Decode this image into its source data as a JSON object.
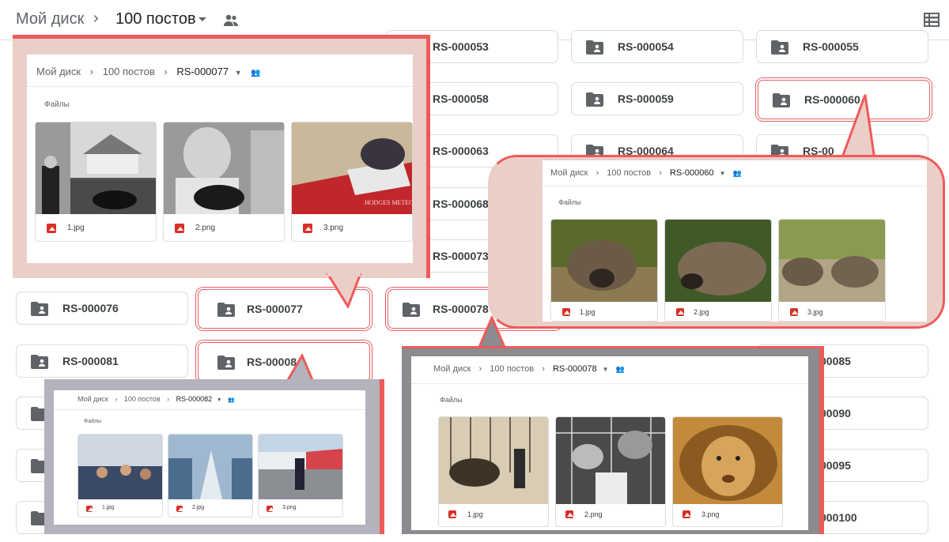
{
  "header": {
    "root": "Мой диск",
    "folder": "100 постов",
    "shared_icon": "people-icon",
    "list_view_icon": "list-view-icon"
  },
  "folders": [
    {
      "label": "RS-000053"
    },
    {
      "label": "RS-000054"
    },
    {
      "label": "RS-000055"
    },
    {
      "label": "RS-000058"
    },
    {
      "label": "RS-000059"
    },
    {
      "label": "RS-000060"
    },
    {
      "label": "RS-000063"
    },
    {
      "label": "RS-000064"
    },
    {
      "label": "RS-00"
    },
    {
      "label": "RS-000068"
    },
    {
      "label": "RS-000073"
    },
    {
      "label": "RS-000076"
    },
    {
      "label": "RS-000077"
    },
    {
      "label": "RS-000078"
    },
    {
      "label": "RS-000081"
    },
    {
      "label": "RS-00008"
    },
    {
      "label": "00085"
    },
    {
      "label": "00090"
    },
    {
      "label": "00095"
    },
    {
      "label": "000100"
    }
  ],
  "callouts": {
    "c77": {
      "root": "Мой диск",
      "folder": "100 постов",
      "sub": "RS-000077",
      "files_label": "Файлы",
      "files": [
        {
          "name": "1.jpg"
        },
        {
          "name": "2.png"
        },
        {
          "name": "3.png"
        }
      ]
    },
    "c60": {
      "root": "Мой диск",
      "folder": "100 постов",
      "sub": "RS-000060",
      "files_label": "Файлы",
      "files": [
        {
          "name": "1.jpg"
        },
        {
          "name": "2.jpg"
        },
        {
          "name": "3.jpg"
        }
      ]
    },
    "c82": {
      "root": "Мой диск",
      "folder": "100 постов",
      "sub": "RS-000082",
      "files_label": "Файлы",
      "files": [
        {
          "name": "1.jpg"
        },
        {
          "name": "2.jpg"
        },
        {
          "name": "3.png"
        }
      ]
    },
    "c78": {
      "root": "Мой диск",
      "folder": "100 постов",
      "sub": "RS-000078",
      "files_label": "Файлы",
      "files": [
        {
          "name": "1.jpg"
        },
        {
          "name": "2.png"
        },
        {
          "name": "3.png"
        }
      ]
    }
  },
  "colors": {
    "accent_red": "#e86262",
    "callout_pink": "#e9cfc8",
    "callout_gray": "#8c8c90",
    "callout_lilac": "#b4b2bc",
    "file_icon_red": "#d93025"
  }
}
